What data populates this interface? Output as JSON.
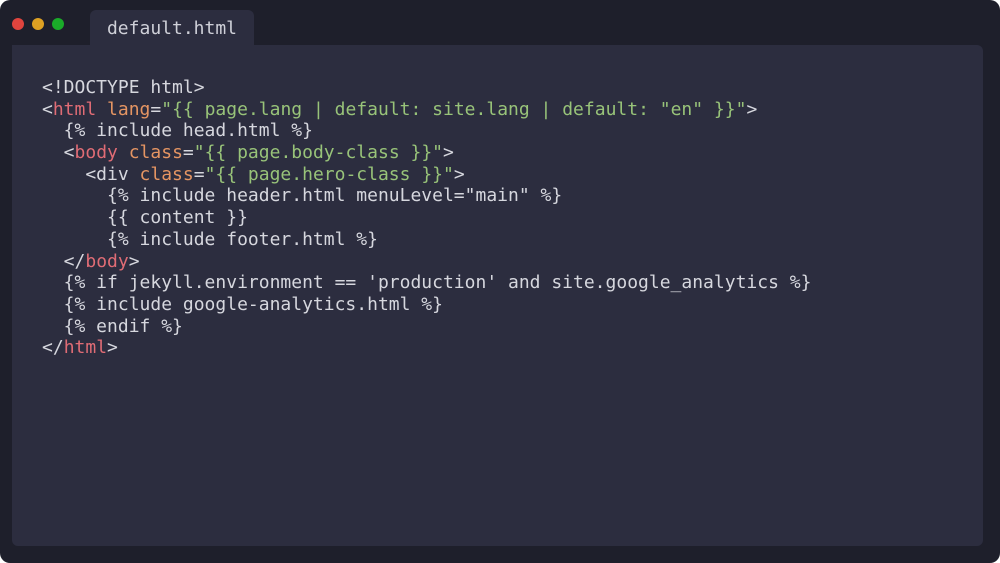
{
  "window": {
    "tab_title": "default.html"
  },
  "colors": {
    "background": "#1e1f2b",
    "editor": "#2c2d3f",
    "text": "#d6d7de",
    "tag": "#e06c75",
    "attribute": "#e59563",
    "string": "#98c379",
    "close_dot": "#e0443e",
    "minimize_dot": "#dea123",
    "maximize_dot": "#1aab29"
  },
  "code_lines": [
    [
      {
        "t": "plain",
        "v": "<!DOCTYPE html>"
      }
    ],
    [
      {
        "t": "plain",
        "v": "<"
      },
      {
        "t": "tag",
        "v": "html"
      },
      {
        "t": "plain",
        "v": " "
      },
      {
        "t": "attr",
        "v": "lang"
      },
      {
        "t": "plain",
        "v": "="
      },
      {
        "t": "str",
        "v": "\"{{ page.lang | default: site.lang | default: \"en\" }}\""
      },
      {
        "t": "plain",
        "v": ">"
      }
    ],
    [
      {
        "t": "plain",
        "v": "  {% include head.html %}"
      }
    ],
    [
      {
        "t": "plain",
        "v": "  <"
      },
      {
        "t": "tag",
        "v": "body"
      },
      {
        "t": "plain",
        "v": " "
      },
      {
        "t": "attr",
        "v": "class"
      },
      {
        "t": "plain",
        "v": "="
      },
      {
        "t": "str",
        "v": "\"{{ page.body-class }}\""
      },
      {
        "t": "plain",
        "v": ">"
      }
    ],
    [
      {
        "t": "plain",
        "v": "    <div "
      },
      {
        "t": "attr",
        "v": "class"
      },
      {
        "t": "plain",
        "v": "="
      },
      {
        "t": "str",
        "v": "\"{{ page.hero-class }}\""
      },
      {
        "t": "plain",
        "v": ">"
      }
    ],
    [
      {
        "t": "plain",
        "v": "      {% include header.html menuLevel=\"main\" %}"
      }
    ],
    [
      {
        "t": "plain",
        "v": "      {{ content }}"
      }
    ],
    [
      {
        "t": "plain",
        "v": "      {% include footer.html %}"
      }
    ],
    [
      {
        "t": "plain",
        "v": "  </"
      },
      {
        "t": "tag",
        "v": "body"
      },
      {
        "t": "plain",
        "v": ">"
      }
    ],
    [
      {
        "t": "plain",
        "v": "  {% if jekyll.environment == 'production' and site.google_analytics %}"
      }
    ],
    [
      {
        "t": "plain",
        "v": "  {% include google-analytics.html %}"
      }
    ],
    [
      {
        "t": "plain",
        "v": "  {% endif %}"
      }
    ],
    [
      {
        "t": "plain",
        "v": "</"
      },
      {
        "t": "tag",
        "v": "html"
      },
      {
        "t": "plain",
        "v": ">"
      }
    ]
  ]
}
